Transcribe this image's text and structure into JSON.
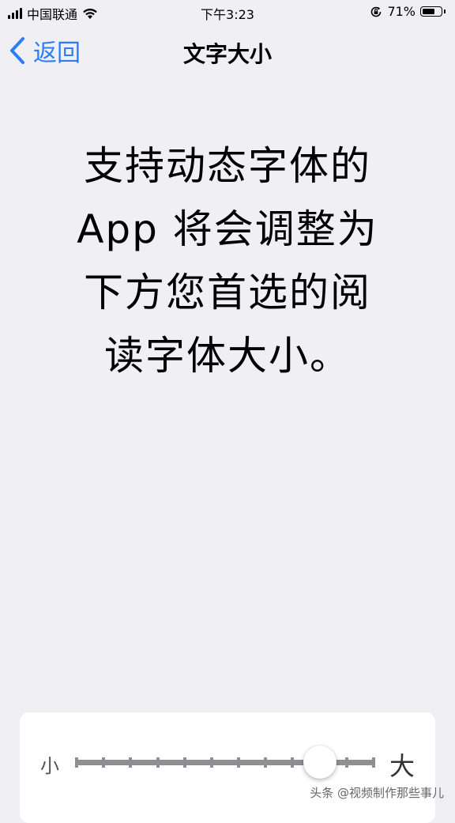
{
  "status_bar": {
    "carrier": "中国联通",
    "time": "下午3:23",
    "battery_percent": "71%",
    "battery_level": 0.71,
    "icons": [
      "signal-icon",
      "wifi-icon",
      "rotation-lock-icon",
      "battery-icon"
    ]
  },
  "nav": {
    "back_label": "返回",
    "title": "文字大小"
  },
  "main": {
    "lines": [
      "支持动态字体的",
      "App 将会调整为",
      "下方您首选的阅",
      "读字体大小。"
    ]
  },
  "slider": {
    "label_small": "小",
    "label_large": "大",
    "steps": 12,
    "current_step": 9
  },
  "watermark": "头条 @视频制作那些事儿",
  "colors": {
    "accent": "#2f7df6",
    "background": "#efeff4",
    "track": "#8e8e93"
  }
}
